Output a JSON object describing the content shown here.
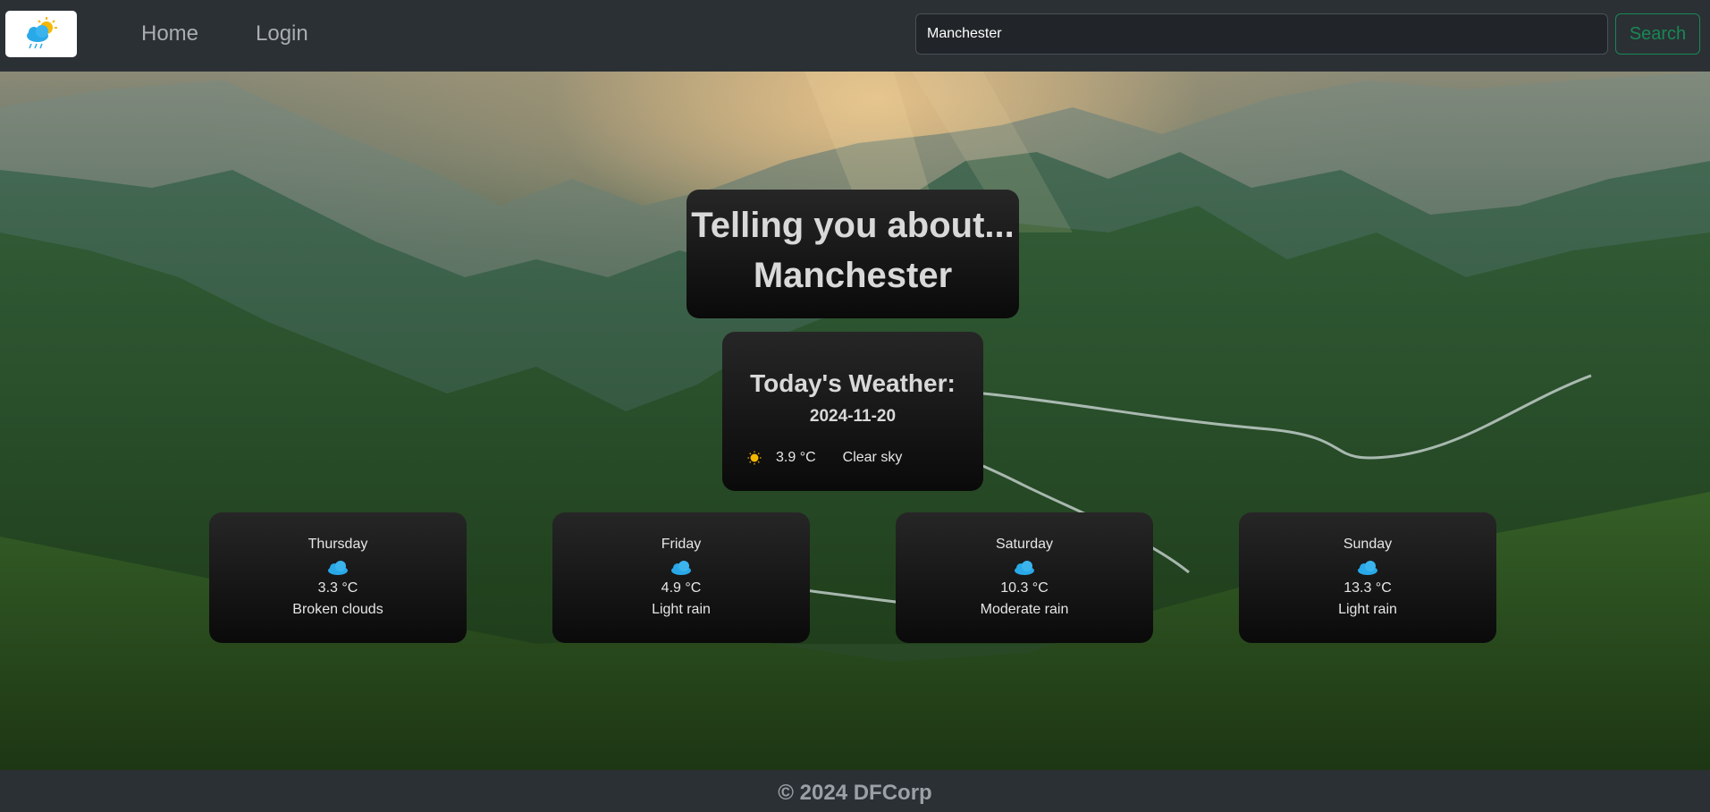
{
  "nav": {
    "logo_icon": "cloud-sun-rain-icon",
    "home_label": "Home",
    "login_label": "Login",
    "search_value": "Manchester",
    "search_button_label": "Search"
  },
  "title": {
    "line1": "Telling you about...",
    "city": "Manchester"
  },
  "today": {
    "heading": "Today's Weather:",
    "date": "2024-11-20",
    "icon": "sun-icon",
    "temperature": "3.9 °C",
    "description": "Clear sky"
  },
  "forecast": [
    {
      "day": "Thursday",
      "icon": "cloud-icon",
      "temperature": "3.3 °C",
      "description": "Broken clouds"
    },
    {
      "day": "Friday",
      "icon": "cloud-icon",
      "temperature": "4.9 °C",
      "description": "Light rain"
    },
    {
      "day": "Saturday",
      "icon": "cloud-icon",
      "temperature": "10.3 °C",
      "description": "Moderate rain"
    },
    {
      "day": "Sunday",
      "icon": "cloud-icon",
      "temperature": "13.3 °C",
      "description": "Light rain"
    }
  ],
  "footer": {
    "text": "© 2024 DFCorp"
  },
  "colors": {
    "navbar_bg": "#2b3035",
    "search_button": "#198754",
    "card_bg": "#1a1a1a",
    "sun": "#f5b800",
    "cloud": "#29a9e8"
  }
}
